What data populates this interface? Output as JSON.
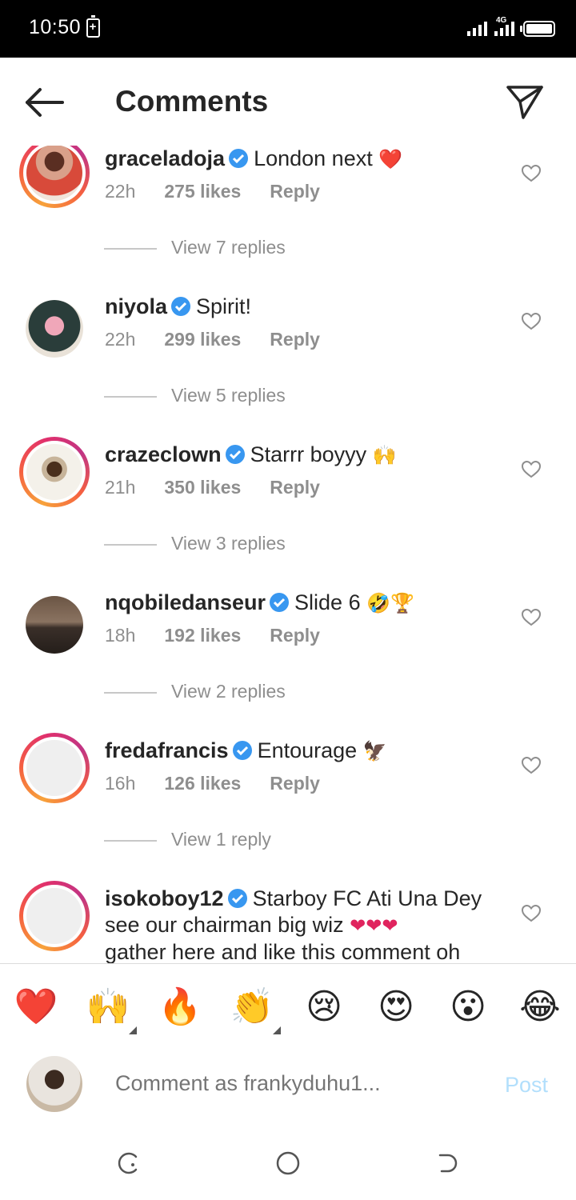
{
  "status": {
    "time": "10:50",
    "network": "4G",
    "battery_icon": "charging-battery-icon"
  },
  "header": {
    "title": "Comments",
    "back_icon": "back-arrow-icon",
    "share_icon": "direct-message-icon"
  },
  "comments": [
    {
      "username": "graceladoja",
      "verified": true,
      "text": "London next",
      "emoji": "❤️",
      "time": "22h",
      "likes": "275 likes",
      "reply": "Reply",
      "view_replies": "View 7 replies"
    },
    {
      "username": "niyola",
      "verified": true,
      "text": "Spirit!",
      "emoji": "",
      "time": "22h",
      "likes": "299 likes",
      "reply": "Reply",
      "view_replies": "View 5 replies"
    },
    {
      "username": "crazeclown",
      "verified": true,
      "text": "Starrr boyyy",
      "emoji": "🙌",
      "time": "21h",
      "likes": "350 likes",
      "reply": "Reply",
      "view_replies": "View 3 replies"
    },
    {
      "username": "nqobiledanseur",
      "verified": true,
      "text": "Slide 6",
      "emoji": "🤣🏆",
      "time": "18h",
      "likes": "192 likes",
      "reply": "Reply",
      "view_replies": "View 2 replies"
    },
    {
      "username": "fredafrancis",
      "verified": true,
      "text": "Entourage",
      "emoji": "🦅",
      "time": "16h",
      "likes": "126 likes",
      "reply": "Reply",
      "view_replies": "View 1 reply"
    },
    {
      "username": "isokoboy12",
      "verified": true,
      "text_1": "Starboy FC Ati Una Dey",
      "text_2": "see our chairman big wiz",
      "hearts": "❤❤❤",
      "text_3": "gather here and like this comment oh"
    }
  ],
  "emoji_bar": [
    "❤️",
    "🙌",
    "🔥",
    "👏",
    "😢",
    "😍",
    "😮",
    "😂"
  ],
  "composer": {
    "placeholder": "Comment as frankyduhu1...",
    "post_label": "Post"
  },
  "colors": {
    "accent_blue": "#3897f0",
    "verified_blue": "#3897f0",
    "post_disabled": "#b2dffc",
    "heart_red": "#e0245e"
  }
}
